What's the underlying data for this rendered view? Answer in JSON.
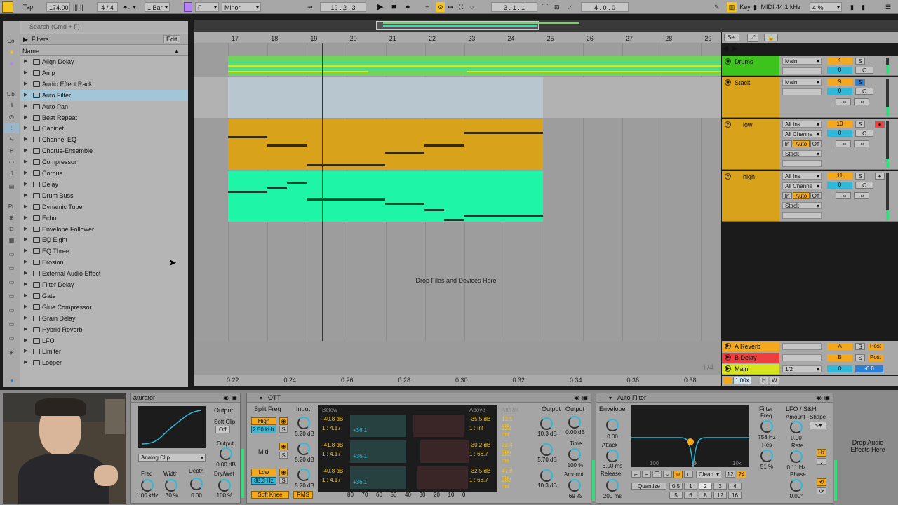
{
  "transport": {
    "tap": "Tap",
    "tempo": "174.00",
    "signature": "4 / 4",
    "quantize": "1 Bar",
    "key": "F",
    "scale": "Minor",
    "position": "19 .  2 .  3",
    "loop_start": "3 .  1 .  1",
    "loop_length": "4 .  0 .  0",
    "key_btn": "Key",
    "midi_btn": "MIDI",
    "sample_rate": "44.1 kHz",
    "cpu": "4 %"
  },
  "browser": {
    "search_placeholder": "Search (Cmd + F)",
    "filters_label": "Filters",
    "edit_label": "Edit",
    "name_col": "Name",
    "side_labels": [
      "Co.",
      "Lib.",
      "Pl."
    ],
    "items": [
      {
        "label": "Align Delay",
        "selected": false
      },
      {
        "label": "Amp",
        "selected": false
      },
      {
        "label": "Audio Effect Rack",
        "selected": false
      },
      {
        "label": "Auto Filter",
        "selected": true
      },
      {
        "label": "Auto Pan",
        "selected": false
      },
      {
        "label": "Beat Repeat",
        "selected": false
      },
      {
        "label": "Cabinet",
        "selected": false
      },
      {
        "label": "Channel EQ",
        "selected": false
      },
      {
        "label": "Chorus-Ensemble",
        "selected": false
      },
      {
        "label": "Compressor",
        "selected": false
      },
      {
        "label": "Corpus",
        "selected": false
      },
      {
        "label": "Delay",
        "selected": false
      },
      {
        "label": "Drum Buss",
        "selected": false
      },
      {
        "label": "Dynamic Tube",
        "selected": false
      },
      {
        "label": "Echo",
        "selected": false
      },
      {
        "label": "Envelope Follower",
        "selected": false
      },
      {
        "label": "EQ Eight",
        "selected": false
      },
      {
        "label": "EQ Three",
        "selected": false
      },
      {
        "label": "Erosion",
        "selected": false
      },
      {
        "label": "External Audio Effect",
        "selected": false
      },
      {
        "label": "Filter Delay",
        "selected": false
      },
      {
        "label": "Gate",
        "selected": false
      },
      {
        "label": "Glue Compressor",
        "selected": false
      },
      {
        "label": "Grain Delay",
        "selected": false
      },
      {
        "label": "Hybrid Reverb",
        "selected": false
      },
      {
        "label": "LFO",
        "selected": false
      },
      {
        "label": "Limiter",
        "selected": false
      },
      {
        "label": "Looper",
        "selected": false
      }
    ]
  },
  "arrangement": {
    "bars": [
      "17",
      "18",
      "19",
      "20",
      "21",
      "22",
      "23",
      "24",
      "25",
      "26",
      "27",
      "28",
      "29"
    ],
    "times": [
      "0:22",
      "0:24",
      "0:26",
      "0:28",
      "0:30",
      "0:32",
      "0:34",
      "0:36",
      "0:38"
    ],
    "drop_text": "Drop Files and Devices Here",
    "set_btn": "Set",
    "zoom_fraction": "1/4"
  },
  "tracks": [
    {
      "name": "Drums",
      "color": "#3dc41c",
      "routing": "Main",
      "number": "1",
      "vol": "0",
      "solo": "S",
      "pan": "C"
    },
    {
      "name": "Stack",
      "color": "#d9a21b",
      "routing": "Main",
      "number": "9",
      "vol": "0",
      "solo": "S",
      "pan": "C",
      "send_a": "-∞",
      "send_b": "-∞"
    },
    {
      "name": "low",
      "color": "#d9a21b",
      "routing": "All Ins",
      "channel": "All Channe",
      "number": "10",
      "vol": "0",
      "solo": "S",
      "pan": "C",
      "in": "In",
      "auto": "Auto",
      "off": "Off",
      "out": "Stack",
      "send_a": "-∞",
      "send_b": "-∞"
    },
    {
      "name": "high",
      "color": "#d9a21b",
      "routing": "All Ins",
      "channel": "All Channe",
      "number": "11",
      "vol": "0",
      "solo": "S",
      "pan": "C",
      "in": "In",
      "auto": "Auto",
      "off": "Off",
      "out": "Stack",
      "send_a": "-∞",
      "send_b": "-∞"
    }
  ],
  "returns": [
    {
      "name": "A Reverb",
      "color": "#f4a81d",
      "letter": "A",
      "s": "S",
      "post": "Post"
    },
    {
      "name": "B Delay",
      "color": "#ef3e3e",
      "letter": "B",
      "s": "S",
      "post": "Post"
    },
    {
      "name": "Main",
      "color": "#d6e51c",
      "routing": "1/2",
      "vol": "0",
      "db": "-6.0"
    }
  ],
  "main_footer": {
    "zoom": "1.00x",
    "h": "H",
    "w": "W"
  },
  "saturator": {
    "title": "aturator",
    "output": "Output",
    "soft_clip": "Soft Clip",
    "soft_clip_val": "Off",
    "output_knob": "Output",
    "output_val": "0.00 dB",
    "mode": "Analog Clip",
    "freq": "Freq",
    "freq_val": "1.00 kHz",
    "width": "Width",
    "width_val": "30 %",
    "depth": "Depth",
    "depth_val": "0.00",
    "drywet": "Dry/Wet",
    "drywet_val": "100 %"
  },
  "ott": {
    "title": "OTT",
    "split_freq": "Split Freq",
    "input": "Input",
    "high": "High",
    "high_freq": "2.50 kHz",
    "mid": "Mid",
    "low": "Low",
    "low_freq": "88.3 Hz",
    "soft_knee": "Soft Knee",
    "rms": "RMS",
    "input_vals": [
      "5.20 dB",
      "5.20 dB",
      "5.20 dB"
    ],
    "below": "Below",
    "above": "Above",
    "att_rel": "Att/Rel",
    "bands": [
      {
        "below_db": "-40.8 dB",
        "below_ratio": "1 : 4.17",
        "gain": "+36.1",
        "above_db": "-35.5 dB",
        "above_ratio": "1 : Inf",
        "att": "13.5 ms",
        "rel": "132 ms",
        "out": "10.3 dB"
      },
      {
        "below_db": "-41.8 dB",
        "below_ratio": "1 : 4.17",
        "gain": "+36.1",
        "above_db": "-30.2 dB",
        "above_ratio": "1 : 66.7",
        "att": "22.4 ms",
        "rel": "282 ms",
        "out": "5.70 dB"
      },
      {
        "below_db": "-40.8 dB",
        "below_ratio": "1 : 4.17",
        "gain": "+36.1",
        "above_db": "-32.5 dB",
        "above_ratio": "1 : 66.7",
        "att": "47.8 ms",
        "rel": "282 ms",
        "out": "10.3 dB"
      }
    ],
    "scale": [
      "80",
      "70",
      "60",
      "50",
      "40",
      "30",
      "20",
      "10",
      "0"
    ],
    "output": "Output",
    "output2": "Output",
    "output2_val": "0.00 dB",
    "time": "Time",
    "time_val": "100 %",
    "amount": "Amount",
    "amount_val": "69 %"
  },
  "auto_filter": {
    "title": "Auto Filter",
    "envelope": "Envelope",
    "env_val": "0.00",
    "attack": "Attack",
    "attack_val": "6.00 ms",
    "release": "Release",
    "release_val": "200 ms",
    "graph_labels": [
      "100",
      "1k",
      "10k"
    ],
    "clean": "Clean",
    "slopes": [
      "12",
      "24"
    ],
    "quantize": "Quantize",
    "q_vals": [
      "0.5",
      "1",
      "2",
      "3",
      "4",
      "5",
      "6",
      "8",
      "12",
      "16"
    ],
    "filter": "Filter",
    "freq": "Freq",
    "freq_val": "758 Hz",
    "res": "Res",
    "res_val": "51 %",
    "lfo": "LFO / S&H",
    "amount": "Amount",
    "amount_val": "0.00",
    "shape": "Shape",
    "rate": "Rate",
    "rate_val": "0.11 Hz",
    "phase": "Phase",
    "phase_val": "0.00°",
    "hz": "Hz"
  },
  "drop_effects": "Drop Audio Effects Here"
}
